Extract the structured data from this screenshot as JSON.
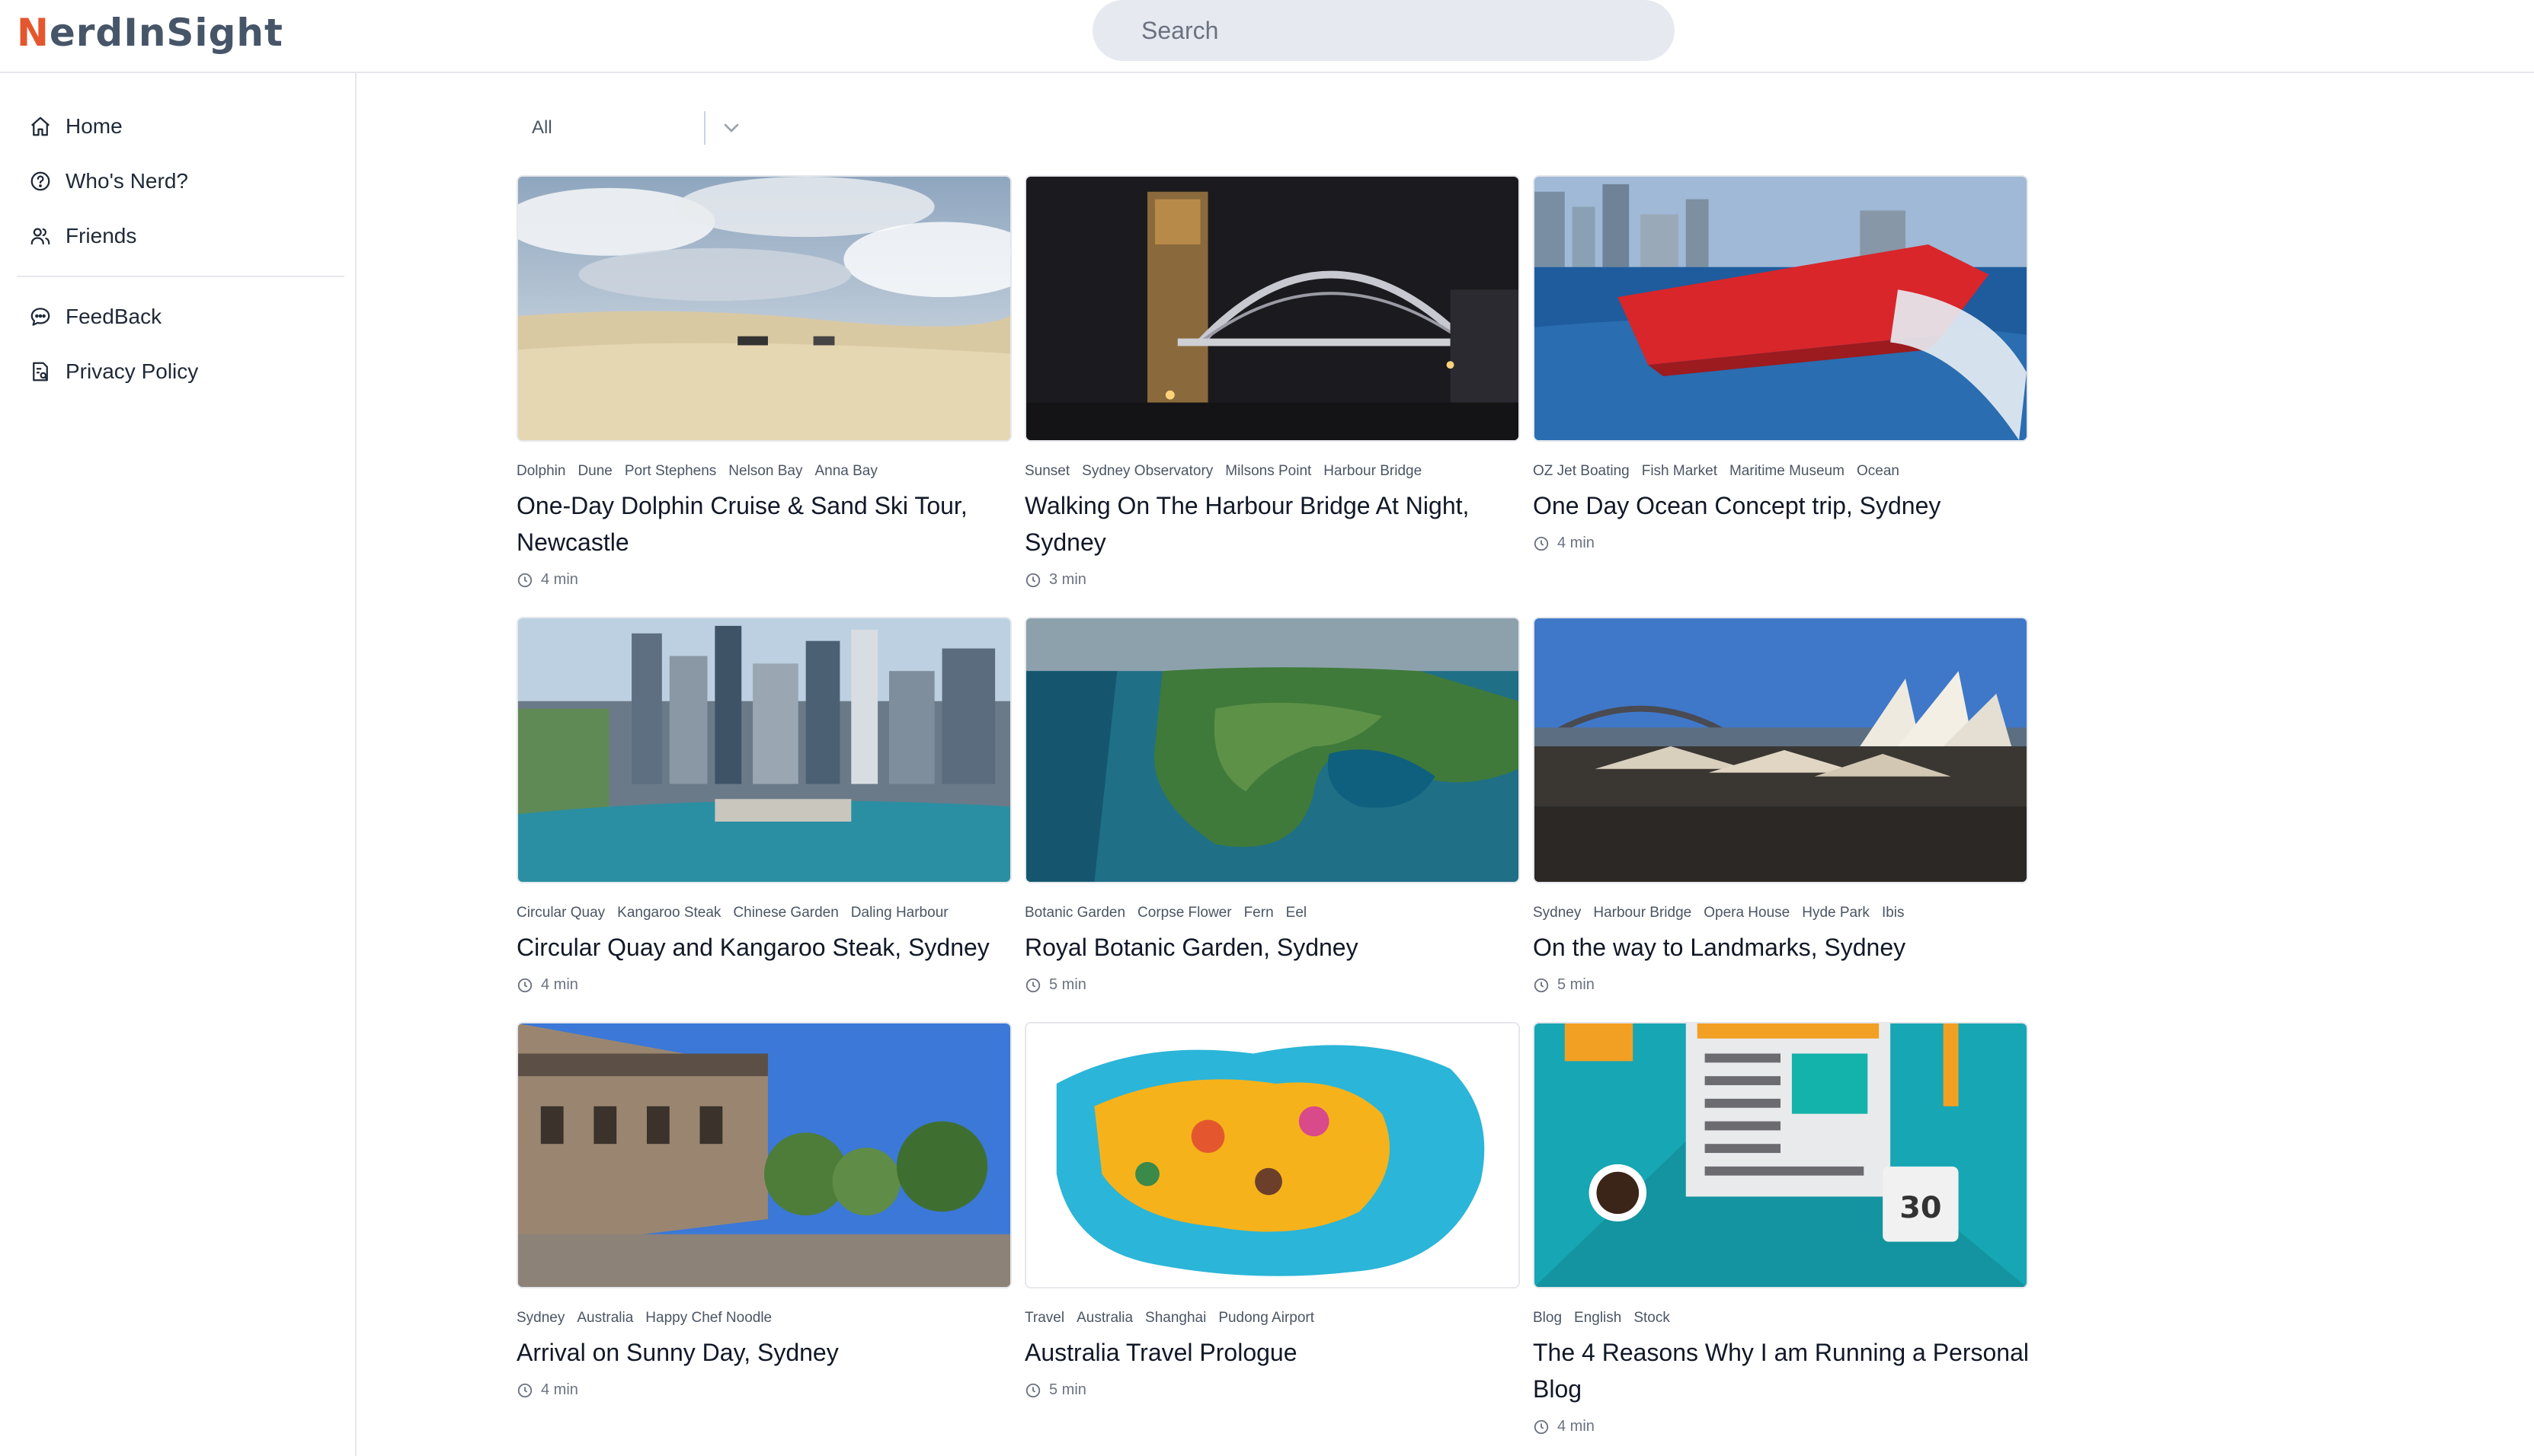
{
  "header": {
    "logo_initial": "N",
    "logo_rest": "erdInSight",
    "search_placeholder": "Search"
  },
  "sidebar": {
    "items": [
      {
        "label": "Home",
        "icon": "home-icon"
      },
      {
        "label": "Who's Nerd?",
        "icon": "question-circle-icon"
      },
      {
        "label": "Friends",
        "icon": "users-icon"
      },
      {
        "label": "FeedBack",
        "icon": "chat-bubble-icon"
      },
      {
        "label": "Privacy Policy",
        "icon": "document-icon"
      }
    ]
  },
  "filter": {
    "selected": "All"
  },
  "cards": [
    {
      "tags": [
        "Dolphin",
        "Dune",
        "Port Stephens",
        "Nelson Bay",
        "Anna Bay"
      ],
      "title": "One-Day Dolphin Cruise & Sand Ski Tour, Newcastle",
      "read_time": "4 min"
    },
    {
      "tags": [
        "Sunset",
        "Sydney Observatory",
        "Milsons Point",
        "Harbour Bridge"
      ],
      "title": "Walking On The Harbour Bridge At Night, Sydney",
      "read_time": "3 min"
    },
    {
      "tags": [
        "OZ Jet Boating",
        "Fish Market",
        "Maritime Museum",
        "Ocean"
      ],
      "title": "One Day Ocean Concept trip, Sydney",
      "read_time": "4 min"
    },
    {
      "tags": [
        "Circular Quay",
        "Kangaroo Steak",
        "Chinese Garden",
        "Daling Harbour"
      ],
      "title": "Circular Quay and Kangaroo Steak, Sydney",
      "read_time": "4 min"
    },
    {
      "tags": [
        "Botanic Garden",
        "Corpse Flower",
        "Fern",
        "Eel"
      ],
      "title": "Royal Botanic Garden, Sydney",
      "read_time": "5 min"
    },
    {
      "tags": [
        "Sydney",
        "Harbour Bridge",
        "Opera House",
        "Hyde Park",
        "Ibis"
      ],
      "title": "On the way to Landmarks, Sydney",
      "read_time": "5 min"
    },
    {
      "tags": [
        "Sydney",
        "Australia",
        "Happy Chef Noodle"
      ],
      "title": "Arrival on Sunny Day, Sydney",
      "read_time": "4 min"
    },
    {
      "tags": [
        "Travel",
        "Australia",
        "Shanghai",
        "Pudong Airport"
      ],
      "title": "Australia Travel Prologue",
      "read_time": "5 min"
    },
    {
      "tags": [
        "Blog",
        "English",
        "Stock"
      ],
      "title": "The 4 Reasons Why I am Running a Personal Blog",
      "read_time": "4 min"
    }
  ]
}
